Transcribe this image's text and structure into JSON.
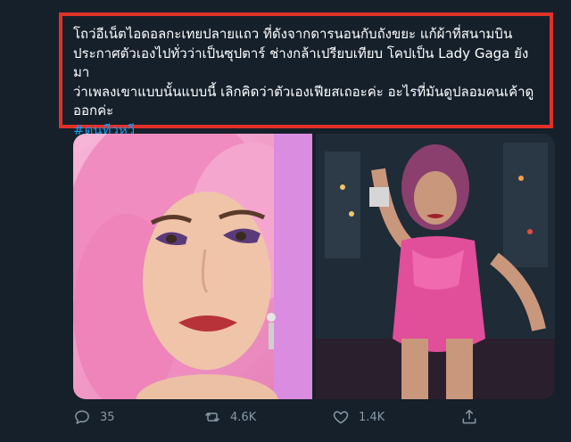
{
  "tweet": {
    "text": "โถว่อีเน็ตไอดอลกะเทยปลายแถว ที่ดังจากดารนอนกับถังขยะ แก้ผ้าที่สนามบิน\nประกาศตัวเองไปทั่วว่าเป็นซุปตาร์ ช่างกล้าเปรียบเทียบ  โคปเป็น Lady Gaga ยังมา\nว่าเพลงเขาแบบนั้นแบบนี้ เลิกคิดว่าตัวเองเฟียสเถอะค่ะ อะไรที่มันดูปลอมคนเค้าดู\nออกค่ะ",
    "hashtag": "#ตูนทีวหวี"
  },
  "media": {
    "left_alt": "pink-haired woman portrait",
    "right_alt": "woman in pink bodysuit on city street"
  },
  "actions": {
    "reply_count": "35",
    "retweet_count": "4.6K",
    "like_count": "1.4K"
  },
  "colors": {
    "background": "#15202b",
    "highlight_border": "#e0312a",
    "hashtag": "#1d9bf0",
    "muted": "#8899a6"
  }
}
